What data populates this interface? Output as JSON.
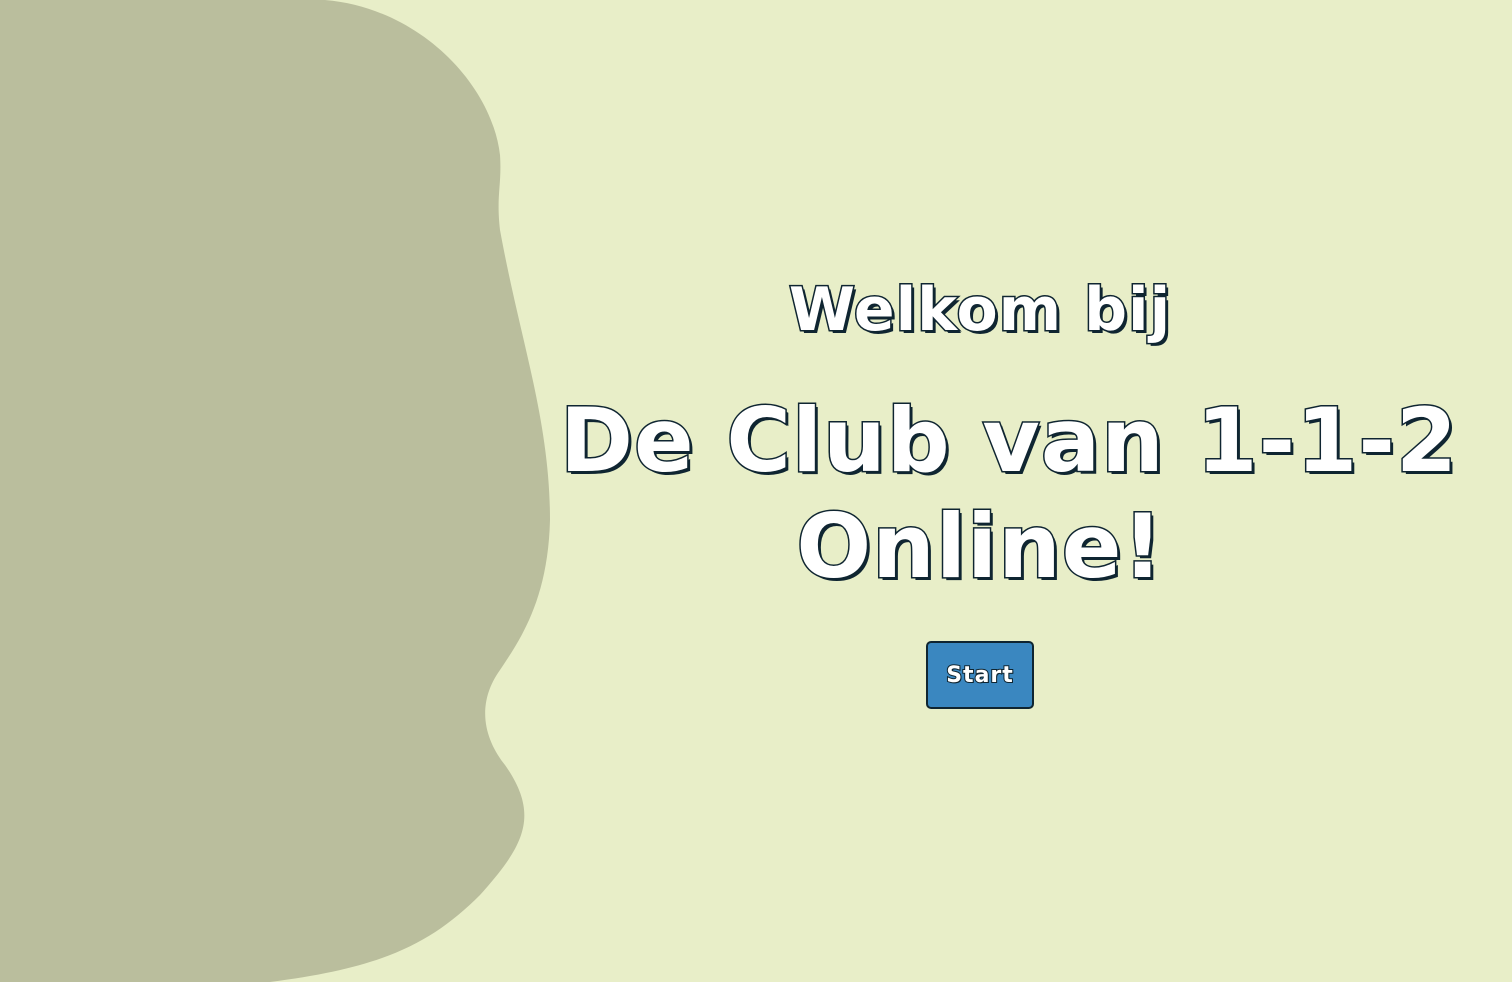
{
  "colors": {
    "background": "#e8eec8",
    "blob": "#babe9d",
    "button": "#3a87c0",
    "outline": "#0f2531",
    "text": "#ffffff"
  },
  "welcome": {
    "line": "Welkom bij"
  },
  "title": {
    "line1": "De Club van 1-1-2",
    "line2": "Online!"
  },
  "start": {
    "label": "Start"
  }
}
